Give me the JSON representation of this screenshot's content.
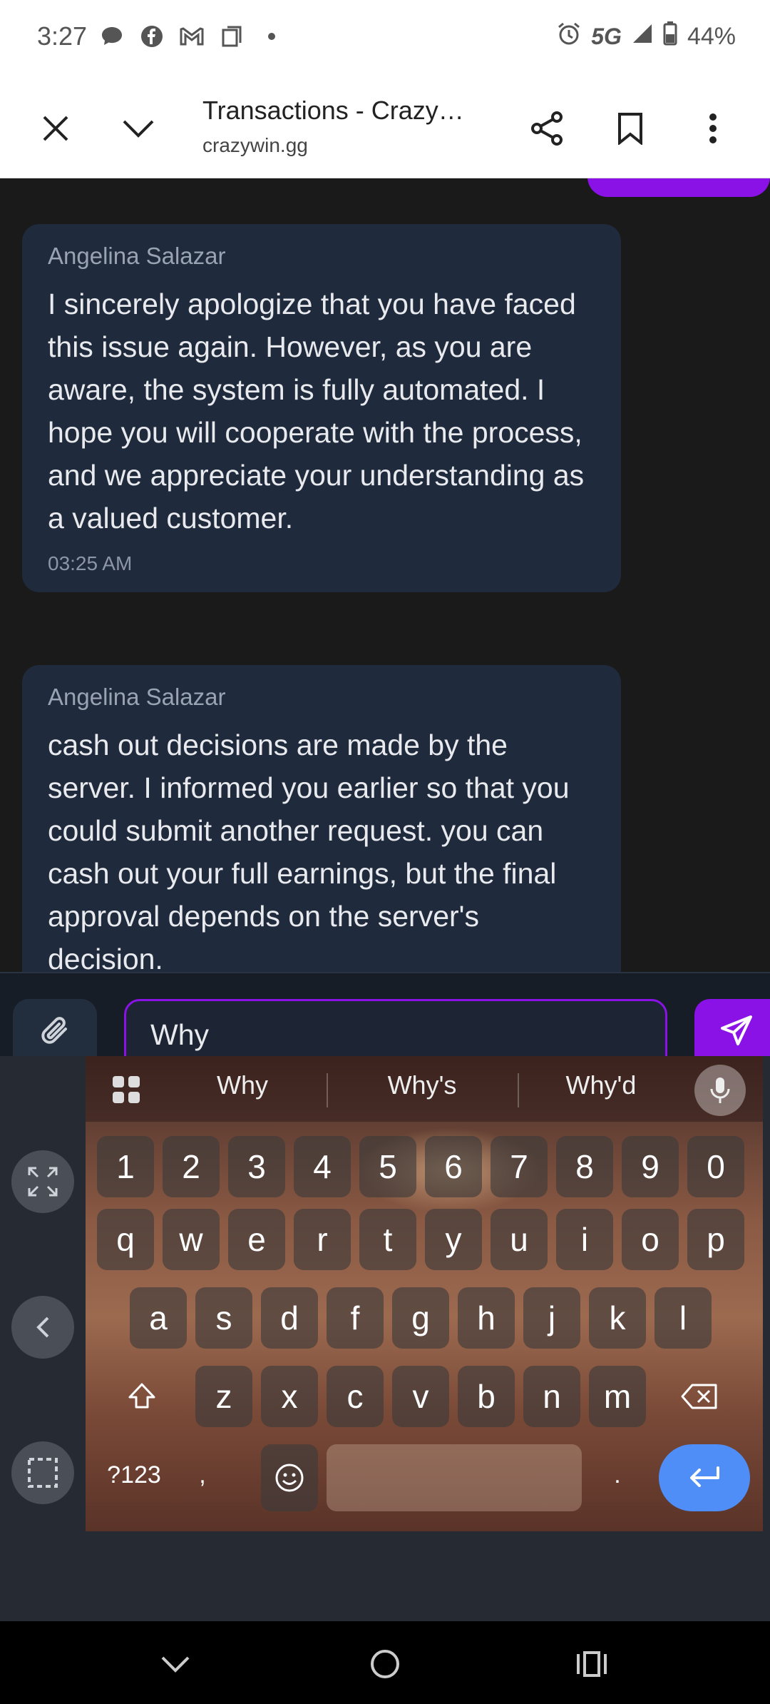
{
  "status": {
    "time": "3:27",
    "network": "5G",
    "battery": "44%",
    "icons_left": [
      "chat-bubble-icon",
      "facebook-icon",
      "gmail-icon",
      "copy-icon",
      "dot-icon"
    ],
    "icons_right": [
      "alarm-icon",
      "signal-icon",
      "battery-icon"
    ]
  },
  "browser": {
    "title": "Transactions - Crazy…",
    "url": "crazywin.gg"
  },
  "messages": [
    {
      "sender": "Angelina Salazar",
      "text": "I sincerely apologize that you have faced this issue again. However, as you are aware, the system is fully automated. I hope you will cooperate with the process, and we appreciate your understanding as a valued customer.",
      "time": "03:25 AM"
    },
    {
      "sender": "Angelina Salazar",
      "text": "cash out decisions are made by the server. I informed you earlier so that you could submit another request. you can cash out your full earnings, but the final approval depends on the server's decision.",
      "time": ""
    }
  ],
  "composer": {
    "value": "Why"
  },
  "keyboard": {
    "suggestions": [
      "Why",
      "Why's",
      "Why'd"
    ],
    "row_numbers": [
      "1",
      "2",
      "3",
      "4",
      "5",
      "6",
      "7",
      "8",
      "9",
      "0"
    ],
    "row1": [
      "q",
      "w",
      "e",
      "r",
      "t",
      "y",
      "u",
      "i",
      "o",
      "p"
    ],
    "row2": [
      "a",
      "s",
      "d",
      "f",
      "g",
      "h",
      "j",
      "k",
      "l"
    ],
    "row3": [
      "z",
      "x",
      "c",
      "v",
      "b",
      "n",
      "m"
    ],
    "symbols_key": "?123",
    "comma_key": ",",
    "period_key": ".",
    "accent_color": "#4f8ef7"
  },
  "colors": {
    "brand_purple": "#8a12e6",
    "bubble_bg": "#1f2a3c"
  }
}
